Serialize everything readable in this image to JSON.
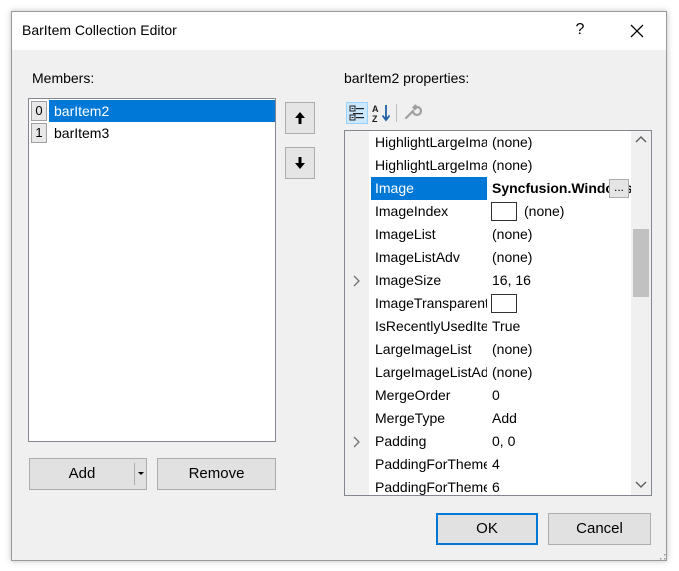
{
  "window": {
    "title": "BarItem Collection Editor",
    "help_glyph": "?"
  },
  "members": {
    "label": "Members:",
    "items": [
      {
        "index": "0",
        "name": "barItem2",
        "selected": true
      },
      {
        "index": "1",
        "name": "barItem3",
        "selected": false
      }
    ]
  },
  "buttons": {
    "add": "Add",
    "remove": "Remove",
    "ok": "OK",
    "cancel": "Cancel",
    "ellipsis": "..."
  },
  "properties": {
    "label": "barItem2 properties:",
    "rows": [
      {
        "name": "HighlightLargeImage",
        "value": "(none)"
      },
      {
        "name": "HighlightLargeImageList",
        "value": "(none)"
      },
      {
        "name": "Image",
        "value": "Syncfusion.Windows.Forms.Tools",
        "selected": true
      },
      {
        "name": "ImageIndex",
        "value": "(none)"
      },
      {
        "name": "ImageList",
        "value": "(none)"
      },
      {
        "name": "ImageListAdv",
        "value": "(none)"
      },
      {
        "name": "ImageSize",
        "value": "16, 16",
        "expandable": true
      },
      {
        "name": "ImageTransparentColor",
        "value": ""
      },
      {
        "name": "IsRecentlyUsedItem",
        "value": "True"
      },
      {
        "name": "LargeImageList",
        "value": "(none)"
      },
      {
        "name": "LargeImageListAdv",
        "value": "(none)"
      },
      {
        "name": "MergeOrder",
        "value": "0"
      },
      {
        "name": "MergeType",
        "value": "Add"
      },
      {
        "name": "Padding",
        "value": "0, 0",
        "expandable": true
      },
      {
        "name": "PaddingForThemes",
        "value": "4"
      },
      {
        "name": "PaddingForThemes",
        "value": "6"
      }
    ]
  },
  "colors": {
    "selection": "#0078d7",
    "dialog_bg": "#f0f0f0"
  }
}
